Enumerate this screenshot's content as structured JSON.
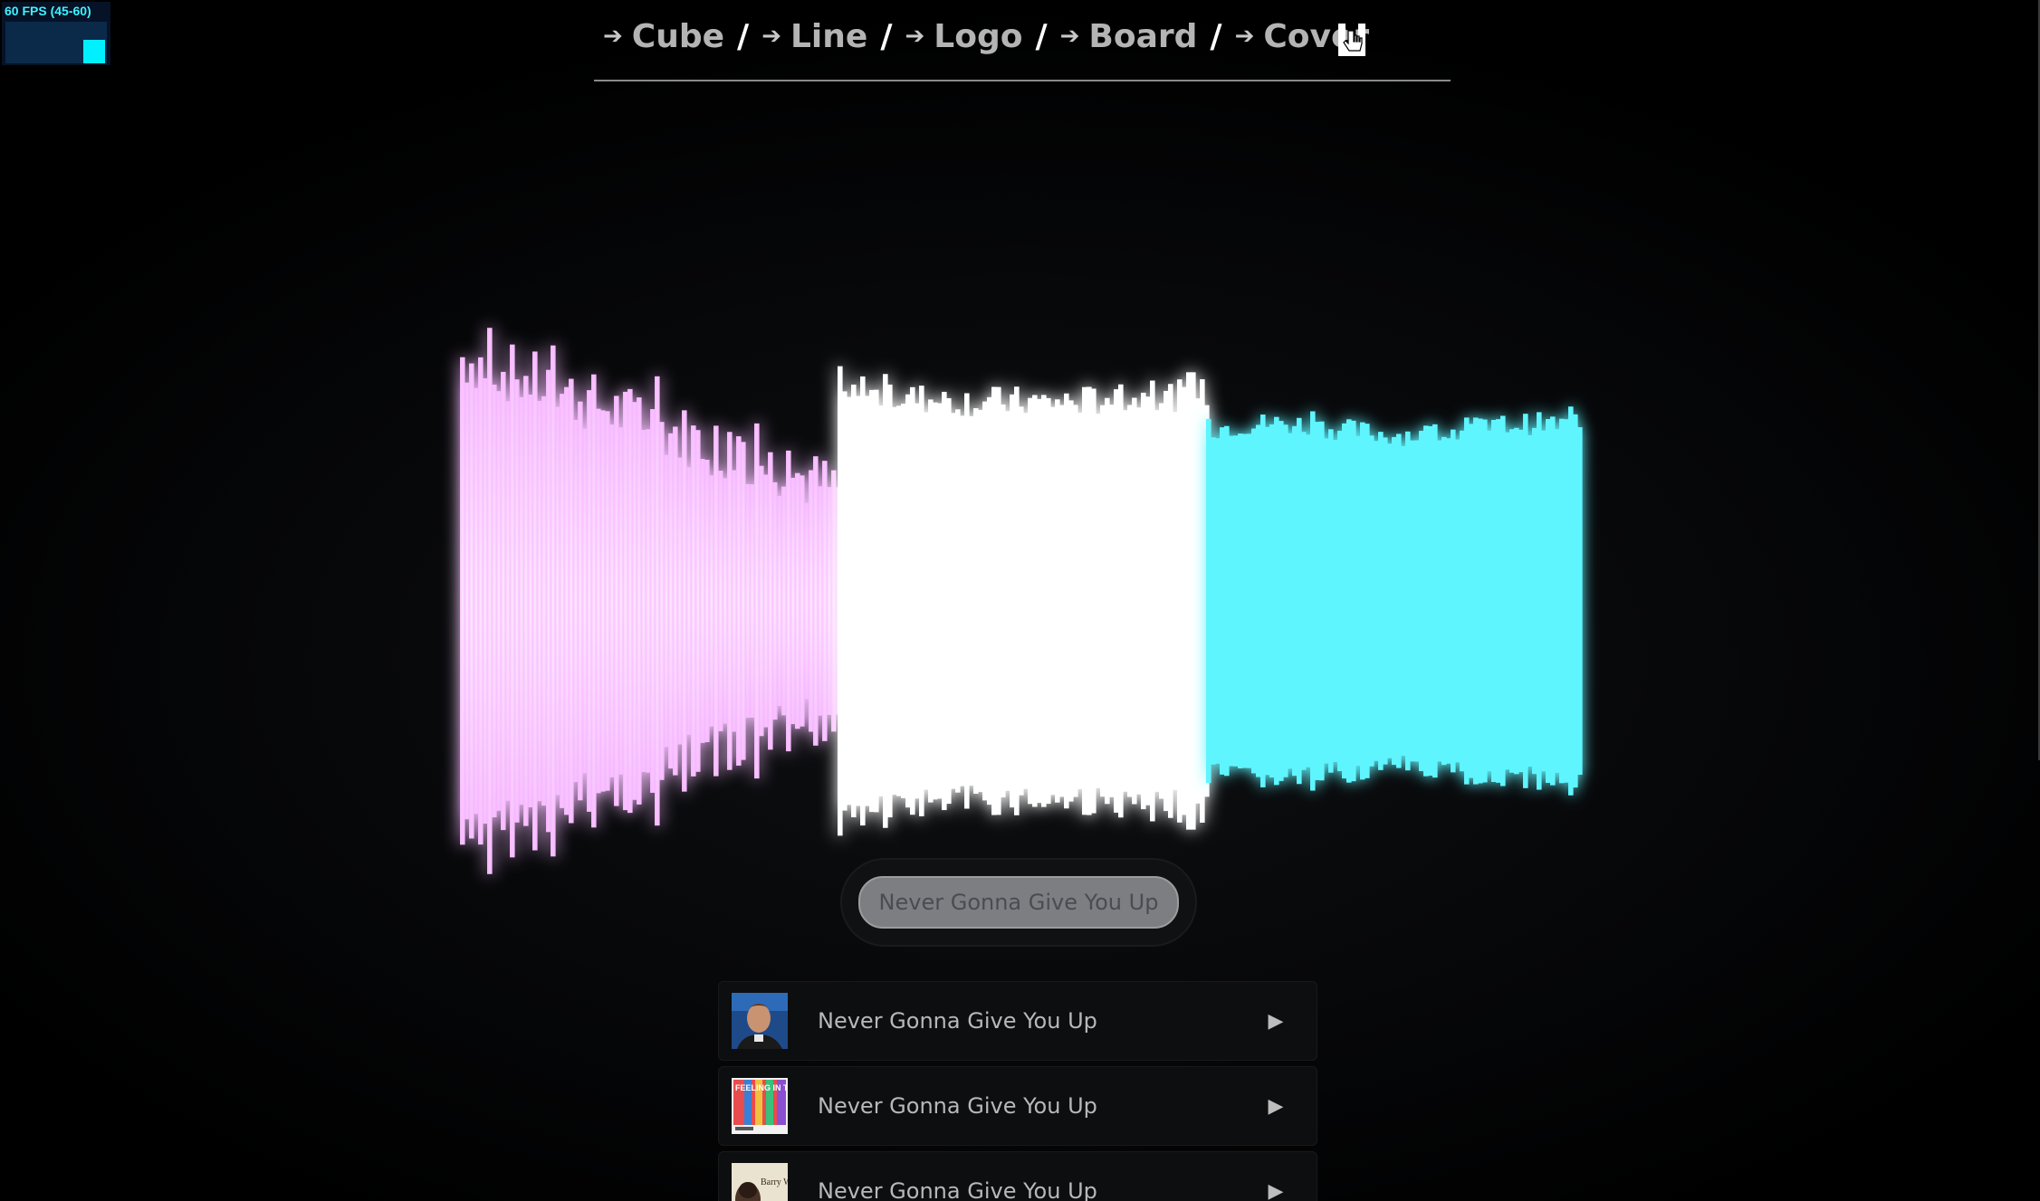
{
  "fps": {
    "label": "60 FPS (45-60)"
  },
  "nav": {
    "items": [
      {
        "label": "Cube"
      },
      {
        "label": "Line"
      },
      {
        "label": "Logo"
      },
      {
        "label": "Board"
      },
      {
        "label": "Cover"
      }
    ],
    "separator": "/",
    "arrow_icon": "arrow-right-icon",
    "cursor_icon": "hand-pointer-icon"
  },
  "visualizer": {
    "colors": {
      "low": "#f7c6ff",
      "mid": "#ffffff",
      "high": "#5ef5ff",
      "glow_low": "#a64bd6",
      "glow_mid": "#6fd5a8",
      "glow_high": "#2fa8e0"
    }
  },
  "now_playing": {
    "title": "Never Gonna Give You Up"
  },
  "playlist": {
    "play_icon": "▶",
    "tracks": [
      {
        "title": "Never Gonna Give You Up",
        "thumb": "portrait"
      },
      {
        "title": "Never Gonna Give You Up",
        "thumb": "feeling"
      },
      {
        "title": "Never Gonna Give You Up",
        "thumb": "barry"
      }
    ],
    "thumb_texts": {
      "feeling": "FEELING IN THE DECADES",
      "barry": "Barry White"
    }
  }
}
